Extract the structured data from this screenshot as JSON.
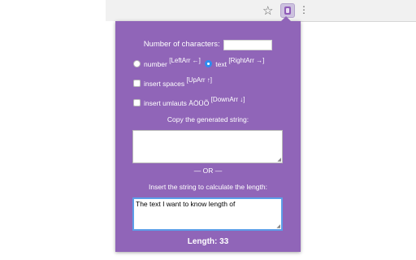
{
  "browser": {
    "star_icon": "star-icon",
    "extension_icon": "extension-icon",
    "menu_icon": "kebab-icon",
    "colors": {
      "toolbar": "#f1f1f1"
    }
  },
  "popup": {
    "colors": {
      "background": "#9065b8",
      "text": "#ffffff",
      "focus_border": "#5c9ee8",
      "radio_checked": "#2f8cf0"
    },
    "num_chars": {
      "label": "Number of characters:",
      "value": ""
    },
    "type_options": [
      {
        "label": "number",
        "hint": "[LeftArr ←]",
        "selected": false
      },
      {
        "label": "text",
        "hint": "[RightArr →]",
        "selected": true
      }
    ],
    "insert_spaces": {
      "label": "insert spaces",
      "hint": "[UpArr ↑]",
      "checked": false
    },
    "insert_umlauts": {
      "label": "insert umlauts ÄÖÜÕ",
      "hint": "[DownArr ↓]",
      "checked": false
    },
    "copy_label": "Copy the generated string:",
    "generated_value": "",
    "or_label": "— OR —",
    "insert_label": "Insert the string to calculate the length:",
    "input_value": "The text I want to know length of",
    "length_text": "Length: 33"
  }
}
